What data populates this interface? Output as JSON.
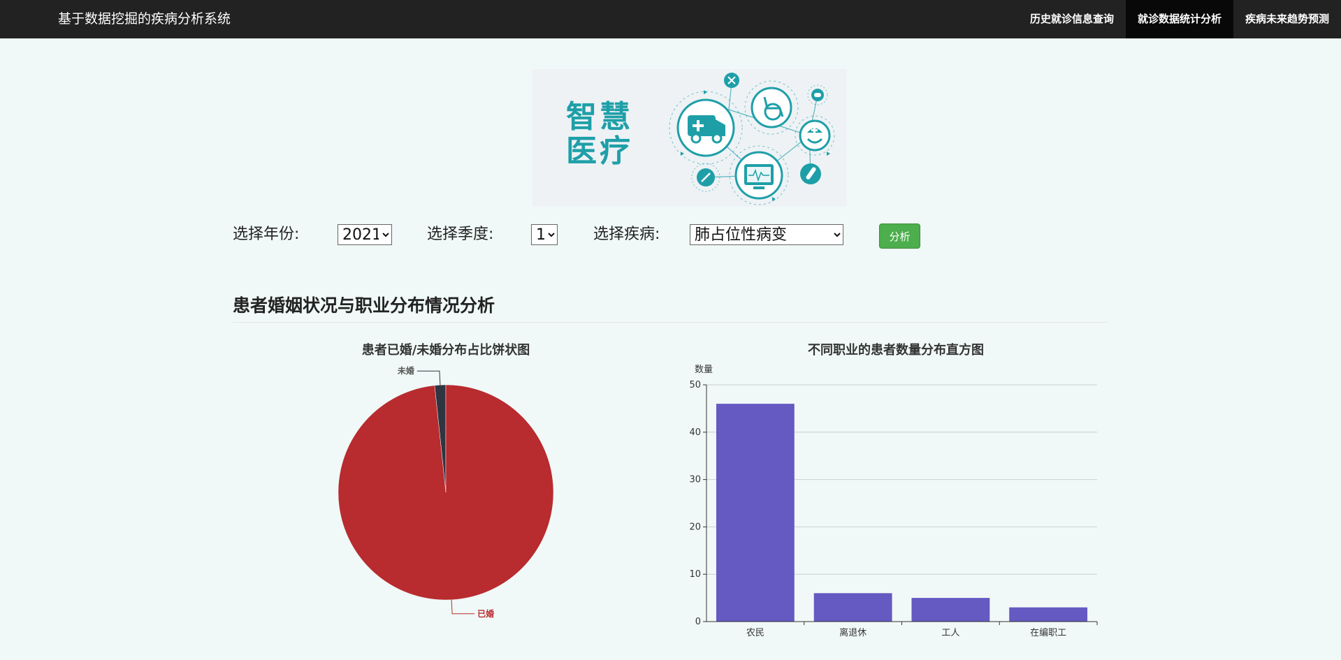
{
  "app": {
    "title": "基于数据挖掘的疾病分析系统"
  },
  "nav": {
    "items": [
      {
        "label": "历史就诊信息查询",
        "active": false
      },
      {
        "label": "就诊数据统计分析",
        "active": true
      },
      {
        "label": "疾病未来趋势预测",
        "active": false
      }
    ]
  },
  "banner": {
    "text_line1": "智慧",
    "text_line2": "医疗",
    "icons": [
      "ambulance-icon",
      "wheelchair-icon",
      "monitor-icon",
      "nurse-icon",
      "syringe-icon",
      "test-tube-icon",
      "scissors-icon",
      "pill-icon"
    ]
  },
  "filters": {
    "year_label": "选择年份:",
    "year_value": "2021",
    "quarter_label": "选择季度:",
    "quarter_value": "1",
    "disease_label": "选择疾病:",
    "disease_value": "肺占位性病变",
    "analyze_label": "分析"
  },
  "section": {
    "title": "患者婚姻状况与职业分布情况分析"
  },
  "colors": {
    "married": "#b82b2f",
    "unmarried": "#2f3541",
    "bars": "#6559c2",
    "accent_teal": "#1e9fa8",
    "button": "#4cae4c"
  },
  "chart_data": [
    {
      "type": "pie",
      "title": "患者已婚/未婚分布占比饼状图",
      "slices": [
        {
          "name": "未婚",
          "value": 1,
          "color": "#2f3541"
        },
        {
          "name": "已婚",
          "value": 59,
          "color": "#b82b2f"
        }
      ],
      "legend": "none"
    },
    {
      "type": "bar",
      "title": "不同职业的患者数量分布直方图",
      "ylabel": "数量",
      "categories": [
        "农民",
        "离退休",
        "工人",
        "在编职工"
      ],
      "values": [
        46,
        6,
        5,
        3
      ],
      "ylim": [
        0,
        50
      ],
      "yticks": [
        0,
        10,
        20,
        30,
        40,
        50
      ],
      "grid": true,
      "color": "#6559c2"
    }
  ]
}
